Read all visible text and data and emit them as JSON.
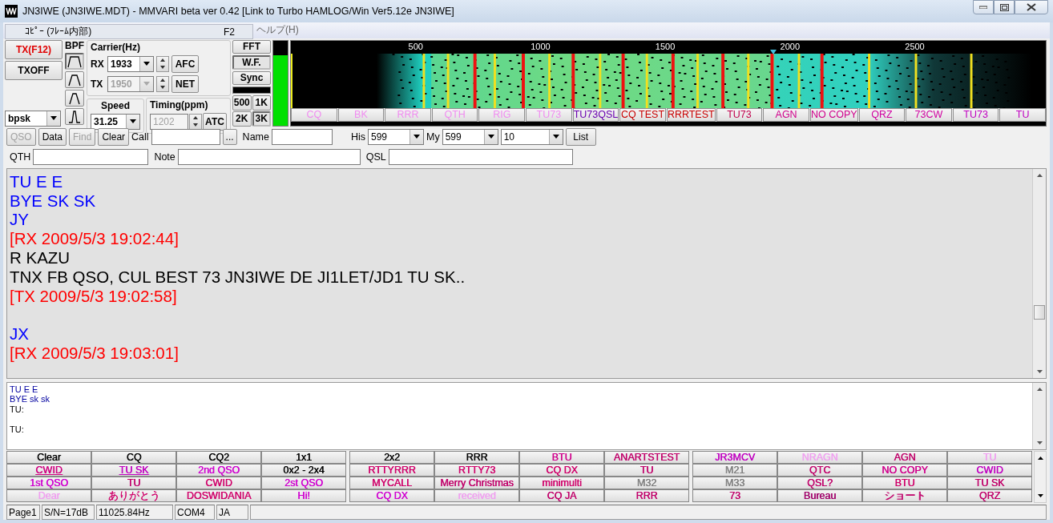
{
  "window": {
    "title": "JN3IWE (JN3IWE.MDT) - MMVARI beta ver 0.42 [Link to Turbo HAMLOG/Win Ver5.12e JN3IWE]"
  },
  "menu": {
    "popup": {
      "label": "ｺﾋﾟｰ (ﾌﾚｰﾑ内部)",
      "shortcut": "F2"
    },
    "items": [
      "ヘルプ(H)"
    ]
  },
  "transmit": {
    "tx_button": "TX(F12)",
    "txoff_button": "TXOFF",
    "mode": "bpsk"
  },
  "bpf": {
    "label": "BPF",
    "filters": [
      {
        "kind": "wide",
        "selected": true
      },
      {
        "kind": "medium",
        "selected": false
      },
      {
        "kind": "narrow",
        "selected": false
      },
      {
        "kind": "narrowest",
        "selected": false
      }
    ]
  },
  "carrier": {
    "label": "Carrier(Hz)",
    "rx": {
      "label": "RX",
      "value": "1933",
      "disabled": false
    },
    "tx": {
      "label": "TX",
      "value": "1950",
      "disabled": true
    },
    "afc_button": "AFC",
    "net_button": "NET"
  },
  "speed": {
    "label": "Speed",
    "value": "31.25"
  },
  "timing": {
    "label": "Timing(ppm)",
    "value": "1202",
    "disabled": true,
    "atc_button": "ATC"
  },
  "view_buttons": [
    {
      "label": "FFT",
      "selected": false
    },
    {
      "label": "W.F.",
      "selected": true
    },
    {
      "label": "Sync",
      "selected": false
    }
  ],
  "bandwidth_buttons": [
    {
      "label": "500",
      "selected": false
    },
    {
      "label": "1K",
      "selected": false
    },
    {
      "label": "2K",
      "selected": false
    },
    {
      "label": "3K",
      "selected": true
    }
  ],
  "level_meter": {
    "level": 0.83
  },
  "waterfall": {
    "scale_labels": [
      "500",
      "1000",
      "1500",
      "2000",
      "2500"
    ],
    "macros": [
      {
        "label": "CQ",
        "color": "#f08cf0"
      },
      {
        "label": "BK",
        "color": "#f08cf0"
      },
      {
        "label": "RRR",
        "color": "#f08cf0"
      },
      {
        "label": "QTH",
        "color": "#f08cf0"
      },
      {
        "label": "RIG",
        "color": "#f08cf0"
      },
      {
        "label": "TU73",
        "color": "#f08cf0"
      },
      {
        "label": "TU73QSL",
        "color": "#6a00b0"
      },
      {
        "label": "CQ TEST",
        "color": "#c80000"
      },
      {
        "label": "RRRTEST",
        "color": "#c80000"
      },
      {
        "label": "TU73",
        "color": "#c0004c"
      },
      {
        "label": "AGN",
        "color": "#d0008c"
      },
      {
        "label": "NO COPY",
        "color": "#d0008c"
      },
      {
        "label": "QRZ",
        "color": "#d000a0"
      },
      {
        "label": "73CW",
        "color": "#d000a0"
      },
      {
        "label": "TU73",
        "color": "#c000c0"
      },
      {
        "label": "TU",
        "color": "#c000c0"
      }
    ]
  },
  "qso_bar": {
    "buttons": [
      {
        "label": "QSO",
        "disabled": true
      },
      {
        "label": "Data",
        "disabled": false
      },
      {
        "label": "Find",
        "disabled": true
      },
      {
        "label": "Clear",
        "disabled": false
      }
    ],
    "call_label": "Call",
    "more_button": "...",
    "name_label": "Name",
    "his_label": "His",
    "his_value": "599",
    "my_label": "My",
    "my_value": "599",
    "band_value": "10",
    "list_button": "List"
  },
  "log_fields": [
    {
      "label": "QTH"
    },
    {
      "label": "Note"
    },
    {
      "label": "QSL"
    }
  ],
  "receive_text": [
    {
      "kind": "received",
      "text": "TU E E"
    },
    {
      "kind": "received",
      "text": "BYE SK SK"
    },
    {
      "kind": "received",
      "text": "JY"
    },
    {
      "kind": "stamp",
      "text": "[RX 2009/5/3 19:02:44]"
    },
    {
      "kind": "sent",
      "text": "R KAZU"
    },
    {
      "kind": "sent",
      "text": "TNX FB QSO, CUL BEST 73 JN3IWE DE JI1LET/JD1 TU SK.."
    },
    {
      "kind": "stamp",
      "text": "[TX 2009/5/3 19:02:58]"
    },
    {
      "kind": "blank"
    },
    {
      "kind": "received",
      "text": "JX"
    },
    {
      "kind": "stamp",
      "text": "[RX 2009/5/3 19:03:01]"
    }
  ],
  "transmit_text": [
    {
      "kind": "macro",
      "text": "TU E E"
    },
    {
      "kind": "macro",
      "text": "BYE sk sk"
    },
    {
      "kind": "typed",
      "text": "TU:"
    },
    {
      "kind": "blank"
    },
    {
      "kind": "typed",
      "text": "TU:"
    }
  ],
  "macro_buttons": [
    [
      {
        "label": "Clear",
        "color": "#000000",
        "underlined": false
      },
      {
        "label": "CQ",
        "color": "#000000",
        "underlined": false
      },
      {
        "label": "CQ2",
        "color": "#000000",
        "underlined": false
      },
      {
        "label": "1x1",
        "color": "#000000",
        "underlined": false
      },
      {
        "label": "2x2",
        "color": "#000000",
        "underlined": false
      },
      {
        "label": "RRR",
        "color": "#000000",
        "underlined": false
      },
      {
        "label": "BTU",
        "color": "#d0008c",
        "underlined": false
      },
      {
        "label": "ANARTSTEST",
        "color": "#c0006a",
        "underlined": false
      },
      {
        "label": "JR3MCV",
        "color": "#c000c0",
        "underlined": false
      },
      {
        "label": "NRAGN",
        "color": "#f0a0f0",
        "underlined": false
      },
      {
        "label": "AGN",
        "color": "#c0006a",
        "underlined": false
      },
      {
        "label": "TU",
        "color": "#f0a0f0",
        "underlined": false
      }
    ],
    [
      {
        "label": "CWID",
        "color": "#d00080",
        "underlined": true
      },
      {
        "label": "TU SK",
        "color": "#c000c0",
        "underlined": true
      },
      {
        "label": "2nd QSO",
        "color": "#d000d0",
        "underlined": false
      },
      {
        "label": "0x2 - 2x4",
        "color": "#000000",
        "underlined": false
      },
      {
        "label": "RTTYRRR",
        "color": "#d0006a",
        "underlined": false
      },
      {
        "label": "RTTY73",
        "color": "#d0006a",
        "underlined": false
      },
      {
        "label": "CQ DX",
        "color": "#d0006a",
        "underlined": false
      },
      {
        "label": "TU",
        "color": "#c0006a",
        "underlined": false
      },
      {
        "label": "M21",
        "color": "#808080",
        "underlined": false
      },
      {
        "label": "QTC",
        "color": "#c0006a",
        "underlined": false
      },
      {
        "label": "NO COPY",
        "color": "#d0008c",
        "underlined": false
      },
      {
        "label": "CWID",
        "color": "#c000c0",
        "underlined": false
      }
    ],
    [
      {
        "label": "1st QSO",
        "color": "#d000d0",
        "underlined": false
      },
      {
        "label": "TU",
        "color": "#c0006a",
        "underlined": false
      },
      {
        "label": "CWID",
        "color": "#d0006a",
        "underlined": false
      },
      {
        "label": "2st QSO",
        "color": "#d000d0",
        "underlined": false
      },
      {
        "label": "MYCALL",
        "color": "#d0006a",
        "underlined": false
      },
      {
        "label": "Merry Christmas",
        "color": "#c0006a",
        "underlined": false
      },
      {
        "label": "minimulti",
        "color": "#d0006a",
        "underlined": false
      },
      {
        "label": "M32",
        "color": "#808080",
        "underlined": false
      },
      {
        "label": "M33",
        "color": "#808080",
        "underlined": false
      },
      {
        "label": "QSL?",
        "color": "#c0006a",
        "underlined": false
      },
      {
        "label": "BTU",
        "color": "#d0006a",
        "underlined": false
      },
      {
        "label": "TU SK",
        "color": "#c0006a",
        "underlined": false
      }
    ],
    [
      {
        "label": "Dear",
        "color": "#f0a0f0",
        "underlined": false
      },
      {
        "label": "ありがとう",
        "color": "#d0006a",
        "underlined": false
      },
      {
        "label": "DOSWIDANIA",
        "color": "#d0006a",
        "underlined": false
      },
      {
        "label": "Hi!",
        "color": "#d000d0",
        "underlined": false
      },
      {
        "label": "CQ DX",
        "color": "#d000d0",
        "underlined": false
      },
      {
        "label": "received",
        "color": "#f0a0f0",
        "underlined": false
      },
      {
        "label": "CQ JA",
        "color": "#c0006a",
        "underlined": false
      },
      {
        "label": "RRR",
        "color": "#c0006a",
        "underlined": false
      },
      {
        "label": "73",
        "color": "#c0006a",
        "underlined": false
      },
      {
        "label": "Bureau",
        "color": "#a0006a",
        "underlined": false
      },
      {
        "label": "ショート",
        "color": "#c0006a",
        "underlined": false
      },
      {
        "label": "QRZ",
        "color": "#c0006a",
        "underlined": false
      }
    ]
  ],
  "status_bar": [
    "Page1",
    "S/N=17dB",
    "11025.84Hz",
    "COM4",
    "JA"
  ]
}
